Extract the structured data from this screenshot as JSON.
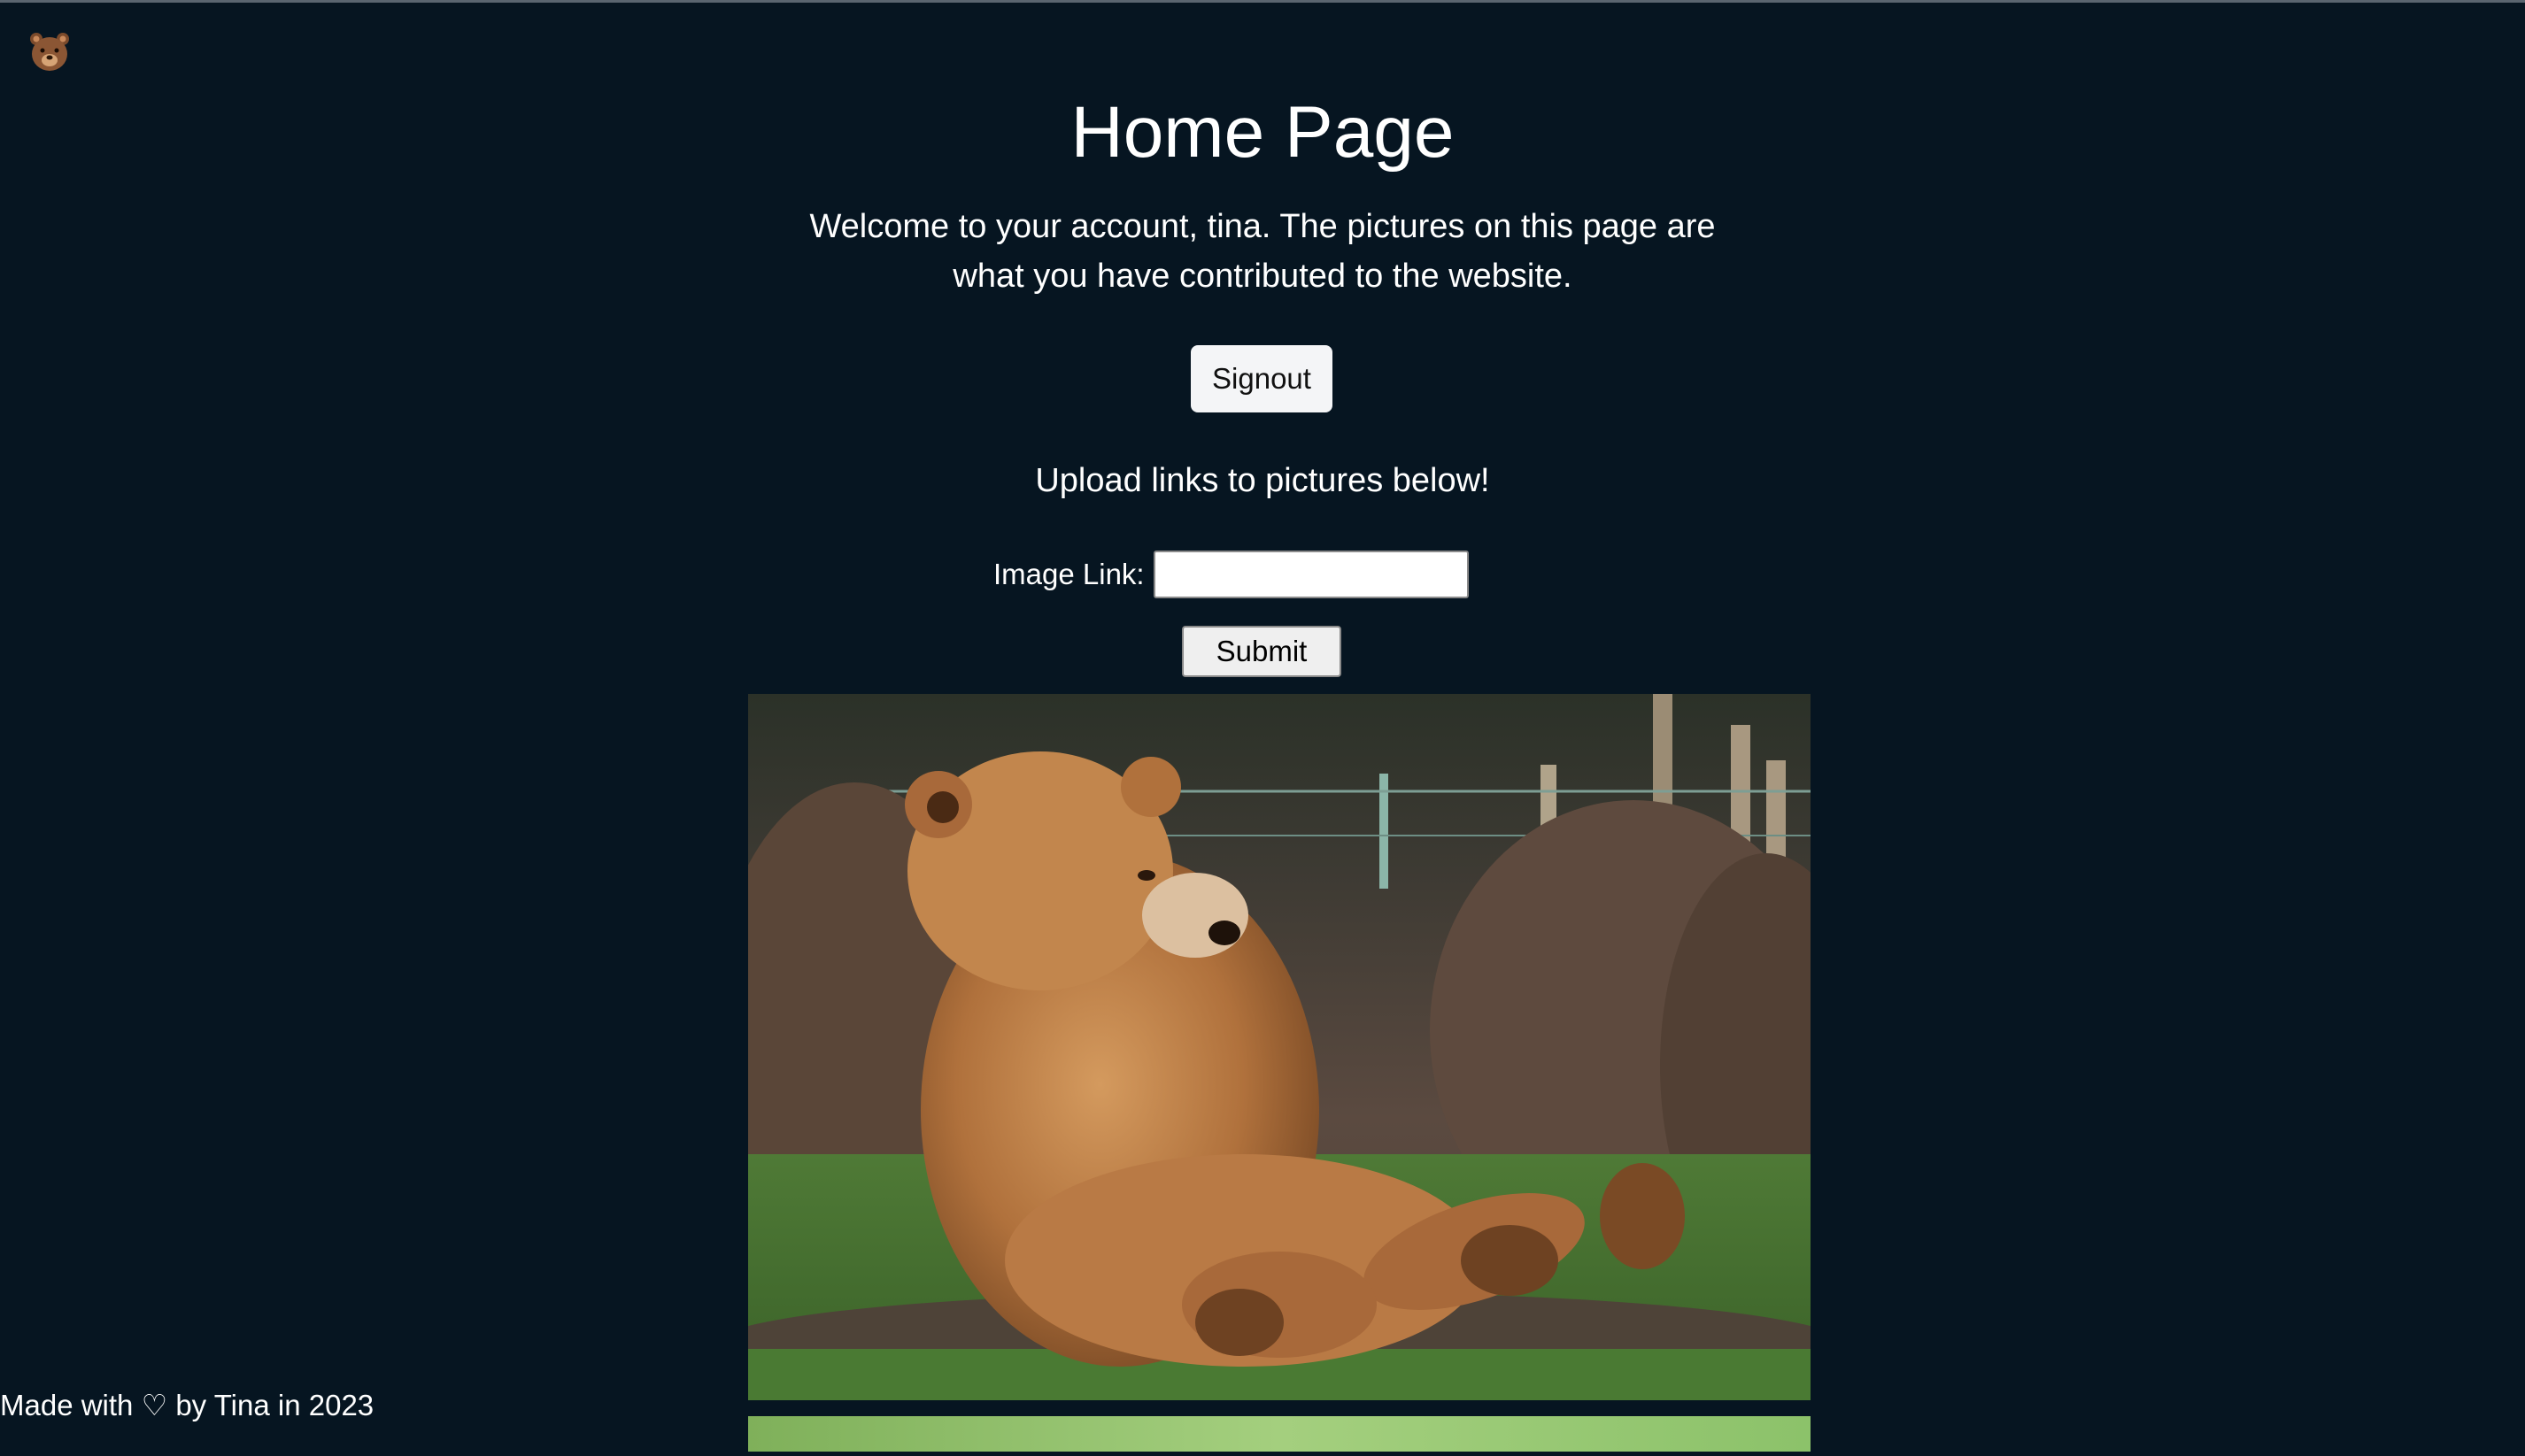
{
  "header": {
    "logo_icon": "bear-face-icon",
    "logo_glyph": "🐻"
  },
  "main": {
    "title": "Home Page",
    "welcome_text": "Welcome to your account, tina. The pictures on this page are what you have contributed to the website.",
    "signout_label": "Signout",
    "upload_text": "Upload links to pictures below!",
    "form": {
      "image_link_label": "Image Link:",
      "image_link_value": "",
      "submit_label": "Submit"
    },
    "gallery": [
      {
        "description_icon": "bear-photo"
      },
      {
        "description_icon": "grass-photo"
      }
    ]
  },
  "footer": {
    "text": "Made with ♡ by Tina in 2023"
  },
  "colors": {
    "background": "#061521",
    "text": "#ffffff"
  }
}
